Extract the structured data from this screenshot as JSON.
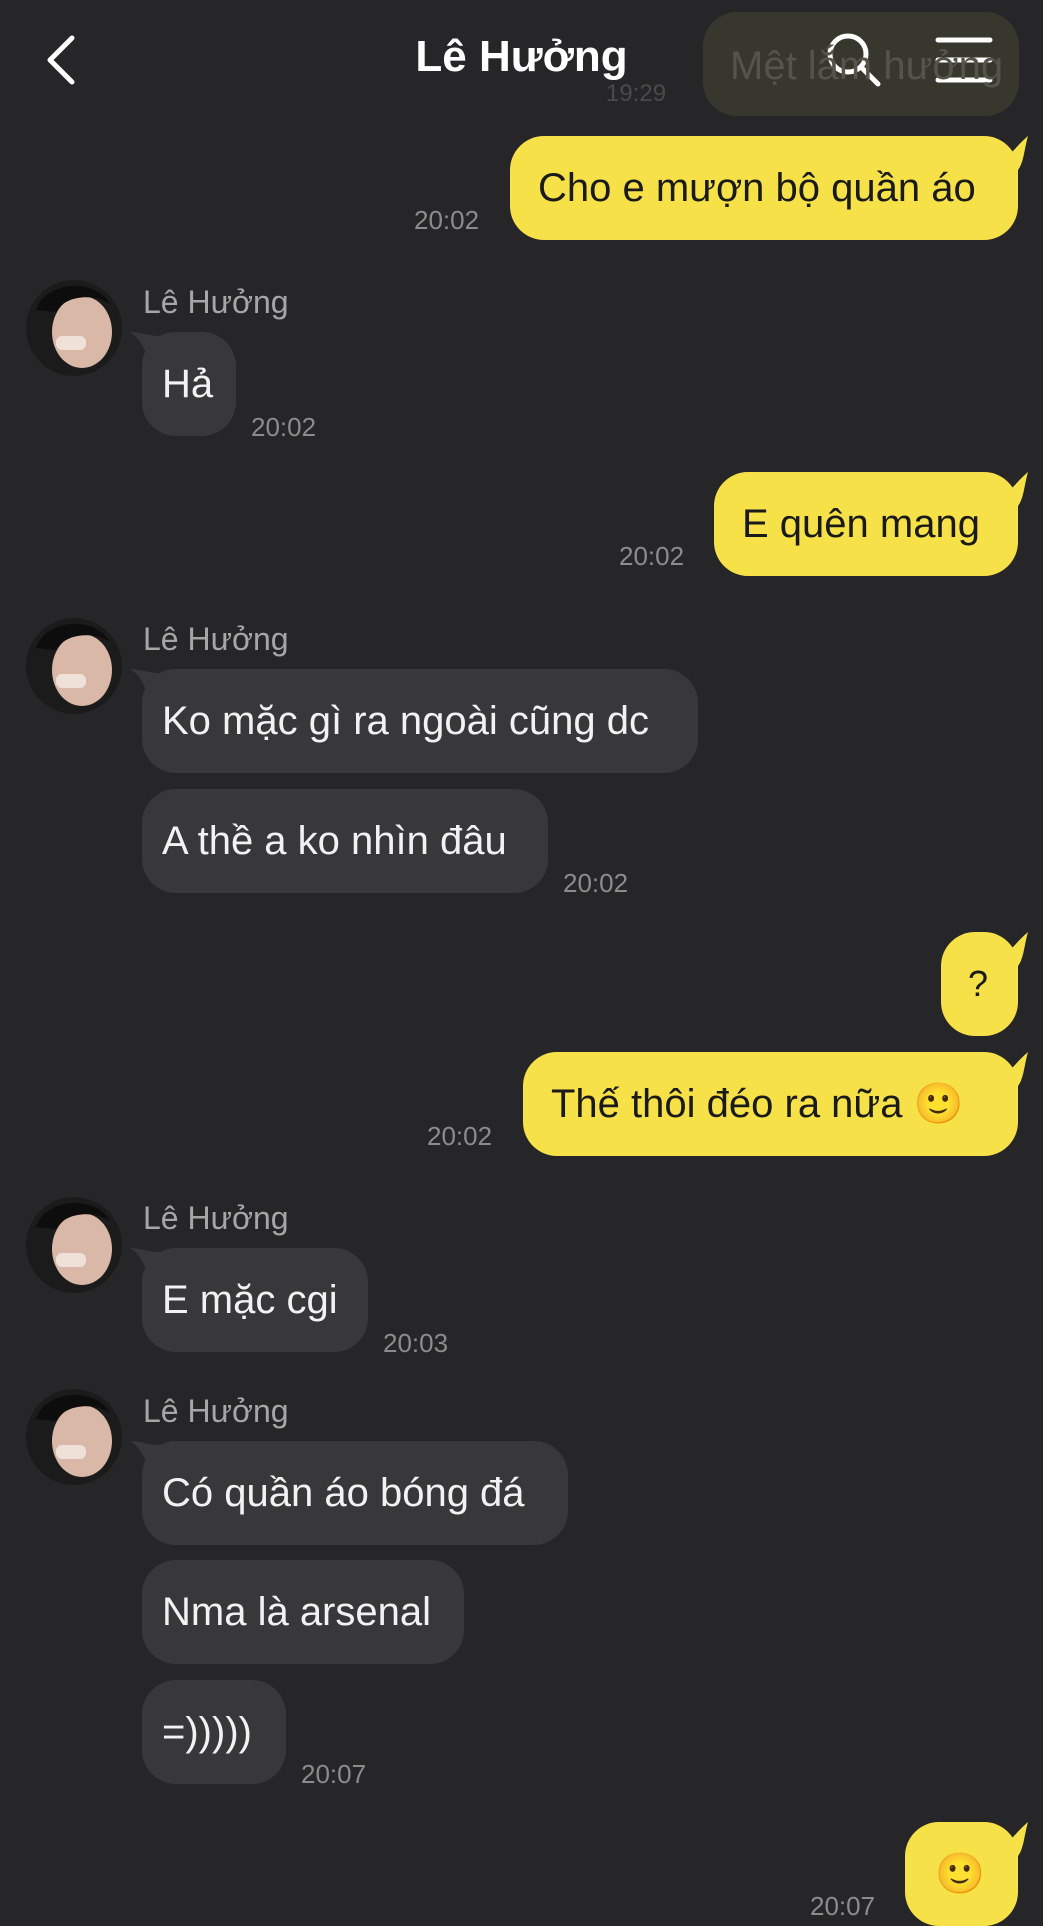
{
  "header": {
    "title": "Lê Hưởng",
    "ghost_text": "Mệt lắm hưởng",
    "ghost_time": "19:29"
  },
  "messages": [
    {
      "dir": "out",
      "text": "Cho e mượn bộ quần áo",
      "time": "20:02"
    },
    {
      "dir": "in",
      "sender": "Lê Hưởng",
      "text": "Hả",
      "time": "20:02"
    },
    {
      "dir": "out",
      "text": "E quên mang",
      "time": "20:02"
    },
    {
      "dir": "in",
      "sender": "Lê Hưởng",
      "text": "Ko mặc gì ra ngoài cũng dc"
    },
    {
      "dir": "in",
      "text": "A thề a ko nhìn đâu",
      "time": "20:02"
    },
    {
      "dir": "out",
      "text": "?"
    },
    {
      "dir": "out",
      "text": "Thế thôi đéo ra nữa 🙂",
      "time": "20:02"
    },
    {
      "dir": "in",
      "sender": "Lê Hưởng",
      "text": "E mặc cgi",
      "time": "20:03"
    },
    {
      "dir": "in",
      "sender": "Lê Hưởng",
      "text": "Có quần áo bóng đá"
    },
    {
      "dir": "in",
      "text": "Nma là arsenal"
    },
    {
      "dir": "in",
      "text": "=)))))",
      "time": "20:07"
    },
    {
      "dir": "out",
      "text": "🙂",
      "time": "20:07"
    }
  ],
  "icons": {
    "back": "chevron-left-icon",
    "search": "search-icon",
    "menu": "hamburger-menu-icon",
    "avatar": "contact-avatar"
  },
  "colors": {
    "background": "#262628",
    "outgoing_bubble": "#f6e148",
    "incoming_bubble": "#38383a",
    "time_text": "#8c8c8c"
  }
}
